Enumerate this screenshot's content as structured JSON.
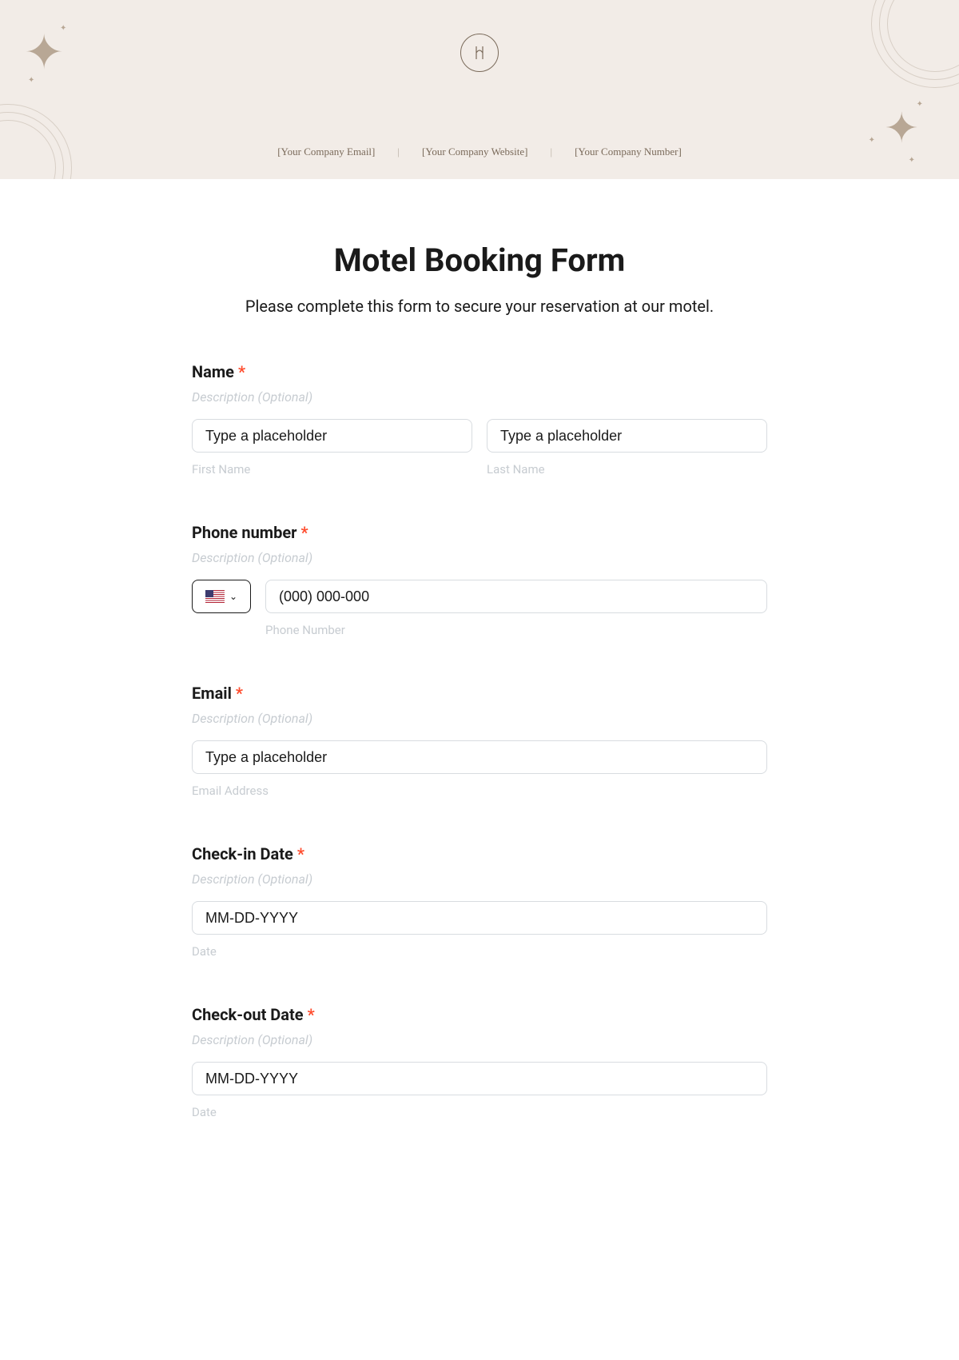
{
  "header": {
    "email": "[Your Company Email]",
    "website": "[Your Company Website]",
    "number": "[Your Company Number]",
    "sep": "|"
  },
  "form": {
    "title": "Motel Booking Form",
    "subtitle": "Please complete this form to secure your reservation at our motel.",
    "desc_optional": "Description (Optional)",
    "req": "*",
    "name": {
      "label": "Name",
      "first_placeholder": "Type a placeholder",
      "last_placeholder": "Type a placeholder",
      "first_sub": "First Name",
      "last_sub": "Last Name"
    },
    "phone": {
      "label": "Phone number",
      "placeholder": "(000) 000-000",
      "sub": "Phone Number"
    },
    "email": {
      "label": "Email",
      "placeholder": "Type a placeholder",
      "sub": "Email Address"
    },
    "checkin": {
      "label": "Check-in Date",
      "placeholder": "MM-DD-YYYY",
      "sub": "Date"
    },
    "checkout": {
      "label": "Check-out Date",
      "placeholder": "MM-DD-YYYY",
      "sub": "Date"
    }
  }
}
